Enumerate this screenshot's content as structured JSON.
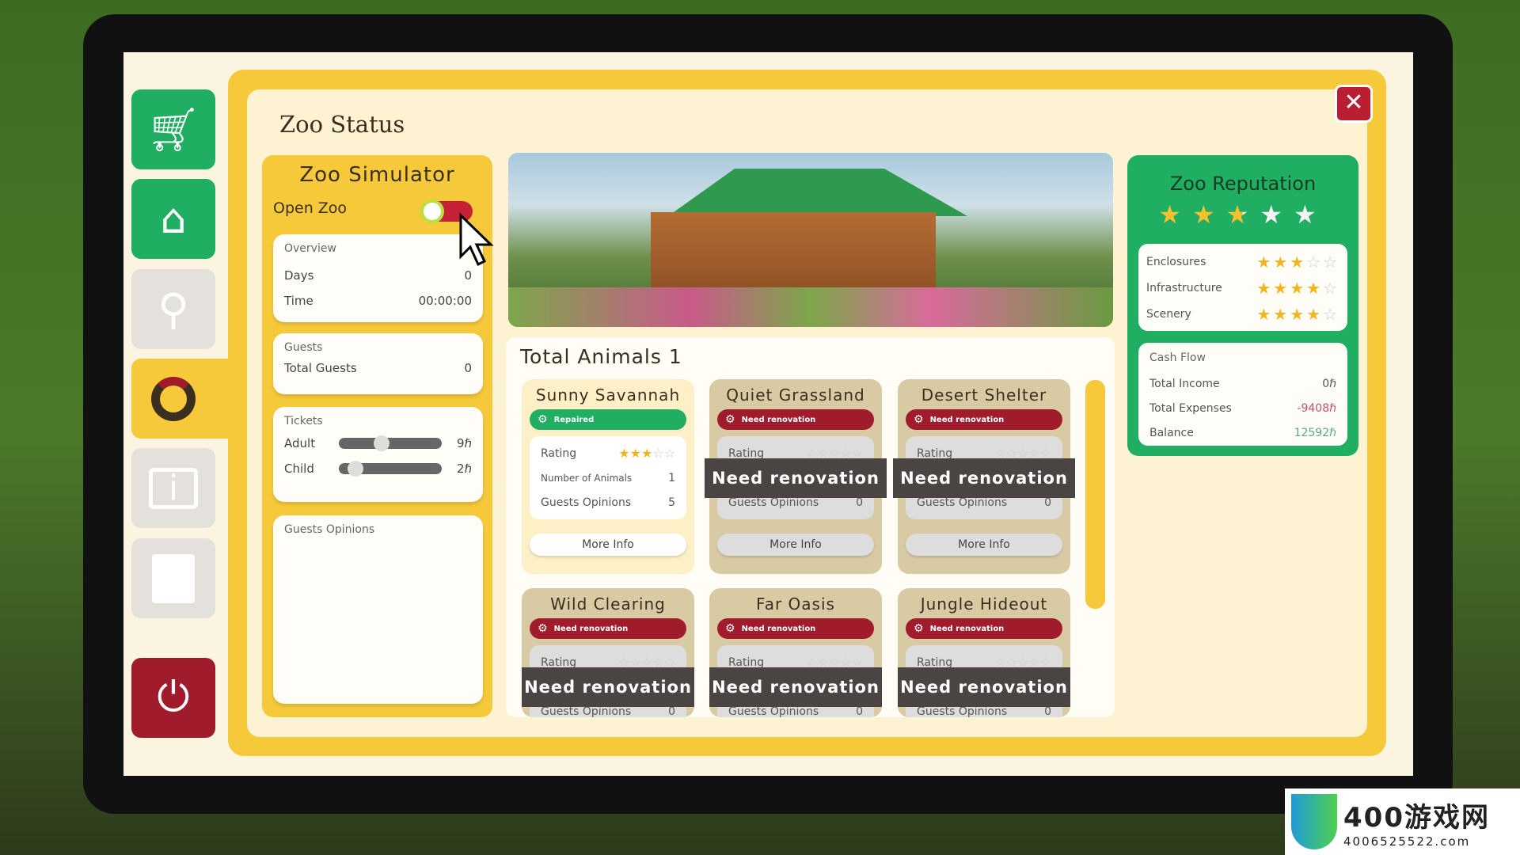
{
  "sidebar": [
    {
      "icon": "cart-icon"
    },
    {
      "icon": "paw-house-icon"
    },
    {
      "icon": "paw-search-icon"
    },
    {
      "icon": "zoo-status-icon",
      "active": true
    },
    {
      "icon": "info-icon"
    },
    {
      "icon": "paw-book-icon"
    },
    {
      "icon": "power-icon"
    }
  ],
  "window": {
    "title": "Zoo Status",
    "close": "✕"
  },
  "left": {
    "title": "Zoo Simulator",
    "open_zoo_label": "Open Zoo",
    "open_zoo_on": true,
    "overview": {
      "heading": "Overview",
      "days_label": "Days",
      "days": "0",
      "time_label": "Time",
      "time": "00:00:00"
    },
    "guests": {
      "heading": "Guests",
      "total_label": "Total Guests",
      "total": "0"
    },
    "tickets": {
      "heading": "Tickets",
      "adult_label": "Adult",
      "adult": "9ℏ",
      "adult_level": 0.4,
      "child_label": "Child",
      "child": "2ℏ",
      "child_level": 0.1
    },
    "opinions": {
      "heading": "Guests Opinions"
    }
  },
  "animals": {
    "title": "Total Animals 1",
    "rating_label": "Rating",
    "num_label": "Number of Animals",
    "opinions_label": "Guests Opinions",
    "more": "More Info",
    "overlay": "Need renovation",
    "cards": [
      {
        "name": "Sunny Savannah",
        "status": "Repaired",
        "ok": true,
        "rating": 3,
        "animals": "1",
        "opinions": "5"
      },
      {
        "name": "Quiet Grassland",
        "status": "Need renovation",
        "ok": false,
        "rating": 0,
        "animals": "0",
        "opinions": "0"
      },
      {
        "name": "Desert Shelter",
        "status": "Need renovation",
        "ok": false,
        "rating": 0,
        "animals": "0",
        "opinions": "0"
      },
      {
        "name": "Wild Clearing",
        "status": "Need renovation",
        "ok": false,
        "rating": 0,
        "animals": "0",
        "opinions": "0"
      },
      {
        "name": "Far Oasis",
        "status": "Need renovation",
        "ok": false,
        "rating": 0,
        "animals": "0",
        "opinions": "0"
      },
      {
        "name": "Jungle Hideout",
        "status": "Need renovation",
        "ok": false,
        "rating": 0,
        "animals": "0",
        "opinions": "0"
      }
    ]
  },
  "reputation": {
    "title": "Zoo Reputation",
    "stars": 2.5,
    "items": [
      {
        "label": "Enclosures",
        "stars": 3
      },
      {
        "label": "Infrastructure",
        "stars": 4
      },
      {
        "label": "Scenery",
        "stars": 4
      }
    ],
    "cash": {
      "heading": "Cash Flow",
      "income_label": "Total Income",
      "income": "0ℏ",
      "expenses_label": "Total Expenses",
      "expenses": "-9408ℏ",
      "balance_label": "Balance",
      "balance": "12592ℏ"
    }
  },
  "colors": {
    "green": "#1fae62",
    "yellow": "#f5c93a",
    "red": "#a01c2c",
    "expense": "#c0506a",
    "balance": "#5aa88a"
  },
  "watermark": {
    "text": "400游戏网",
    "sub": "4006525522.com"
  }
}
